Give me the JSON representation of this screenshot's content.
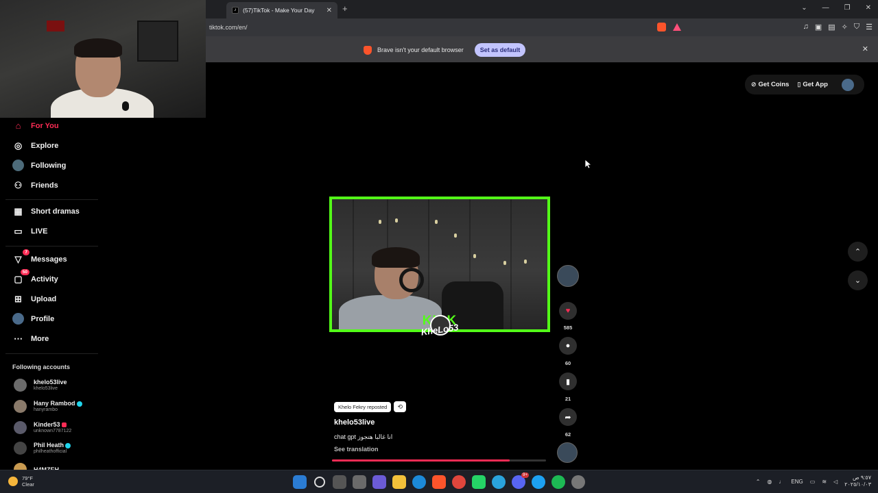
{
  "browser": {
    "tab_title": "(57)TikTok - Make Your Day",
    "url": "tiktok.com/en/",
    "infobar_text": "Brave isn't your default browser",
    "set_default_label": "Set as default"
  },
  "sidebar": {
    "items": [
      {
        "label": "For You",
        "icon": "home-icon"
      },
      {
        "label": "Explore",
        "icon": "compass-icon"
      },
      {
        "label": "Following",
        "icon": "following-avatar-icon"
      },
      {
        "label": "Friends",
        "icon": "friends-icon"
      },
      {
        "label": "Short dramas",
        "icon": "film-icon"
      },
      {
        "label": "LIVE",
        "icon": "live-tv-icon"
      },
      {
        "label": "Messages",
        "icon": "paper-plane-icon",
        "badge": "7"
      },
      {
        "label": "Activity",
        "icon": "inbox-icon",
        "badge": "50"
      },
      {
        "label": "Upload",
        "icon": "plus-square-icon"
      },
      {
        "label": "Profile",
        "icon": "profile-avatar-icon"
      },
      {
        "label": "More",
        "icon": "ellipsis-icon"
      }
    ],
    "following_title": "Following accounts",
    "accounts": [
      {
        "name": "khelo53live",
        "handle": "khelo53live"
      },
      {
        "name": "Hany Rambod",
        "handle": "hanyrambo"
      },
      {
        "name": "Kinder53",
        "handle": "unknown7787122"
      },
      {
        "name": "Phil Heath",
        "handle": "philheathofficial"
      },
      {
        "name": "H4MZEH",
        "handle": ""
      }
    ]
  },
  "header": {
    "get_coins": "Get Coins",
    "get_app": "Get App"
  },
  "video": {
    "watermark_text": "KICK",
    "watermark_signature": "KheLo53",
    "reposted_by": "Khelo Fekry reposted",
    "author": "khelo53live",
    "description": "chat gpt انا غالبا هتجوز",
    "see_translation": "See translation",
    "progress": 0.83
  },
  "actions": {
    "likes": "585",
    "comments": "60",
    "saves": "21",
    "shares": "62"
  },
  "taskbar": {
    "temperature": "79°F",
    "condition": "Clear",
    "language": "ENG",
    "time": "٩:٥٧ ص",
    "date": "٢٠٢٥/١٠/٠٣"
  }
}
